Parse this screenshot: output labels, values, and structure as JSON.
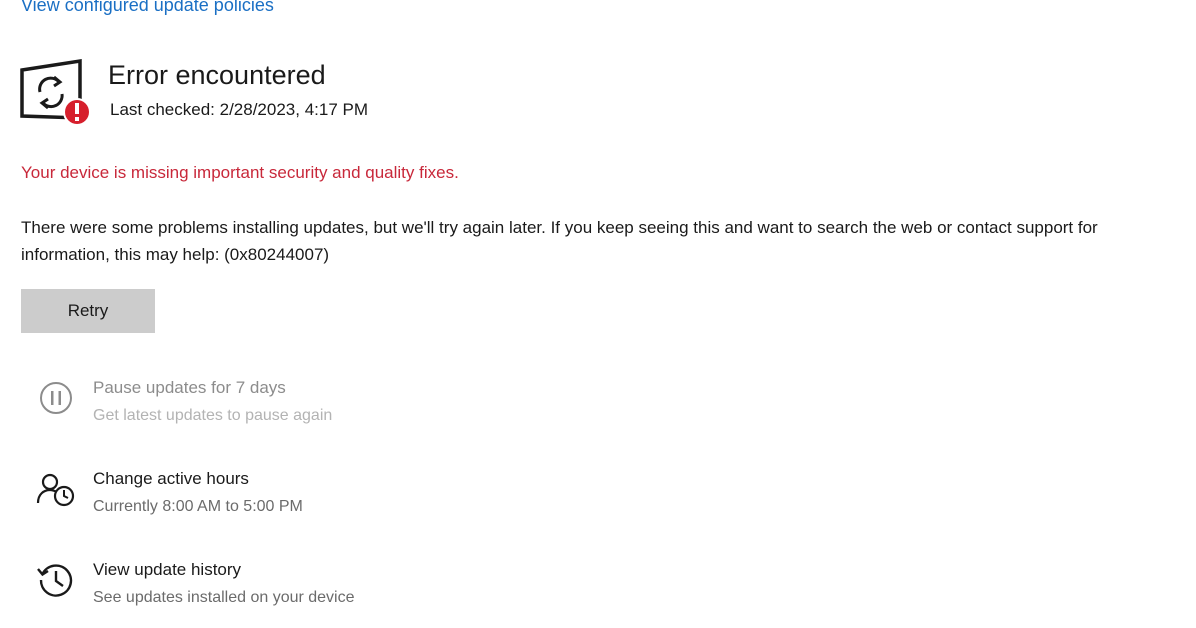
{
  "header": {
    "policies_link": "View configured update policies"
  },
  "status": {
    "icon": "update-error-icon",
    "title": "Error encountered",
    "last_checked": "Last checked: 2/28/2023, 4:17 PM"
  },
  "warning": "Your device is missing important security and quality fixes.",
  "details": "There were some problems installing updates, but we'll try again later. If you keep seeing this and want to search the web or contact support for information, this may help: (0x80244007)",
  "retry_label": "Retry",
  "colors": {
    "link": "#1a6fc4",
    "warning": "#c8283a",
    "error_badge": "#d61f2c",
    "button": "#cccccc"
  },
  "options": [
    {
      "icon": "pause-icon",
      "title": "Pause updates for 7 days",
      "subtitle": "Get latest updates to pause again",
      "disabled": true
    },
    {
      "icon": "active-hours-icon",
      "title": "Change active hours",
      "subtitle": "Currently 8:00 AM to 5:00 PM",
      "disabled": false
    },
    {
      "icon": "history-icon",
      "title": "View update history",
      "subtitle": "See updates installed on your device",
      "disabled": false
    }
  ]
}
